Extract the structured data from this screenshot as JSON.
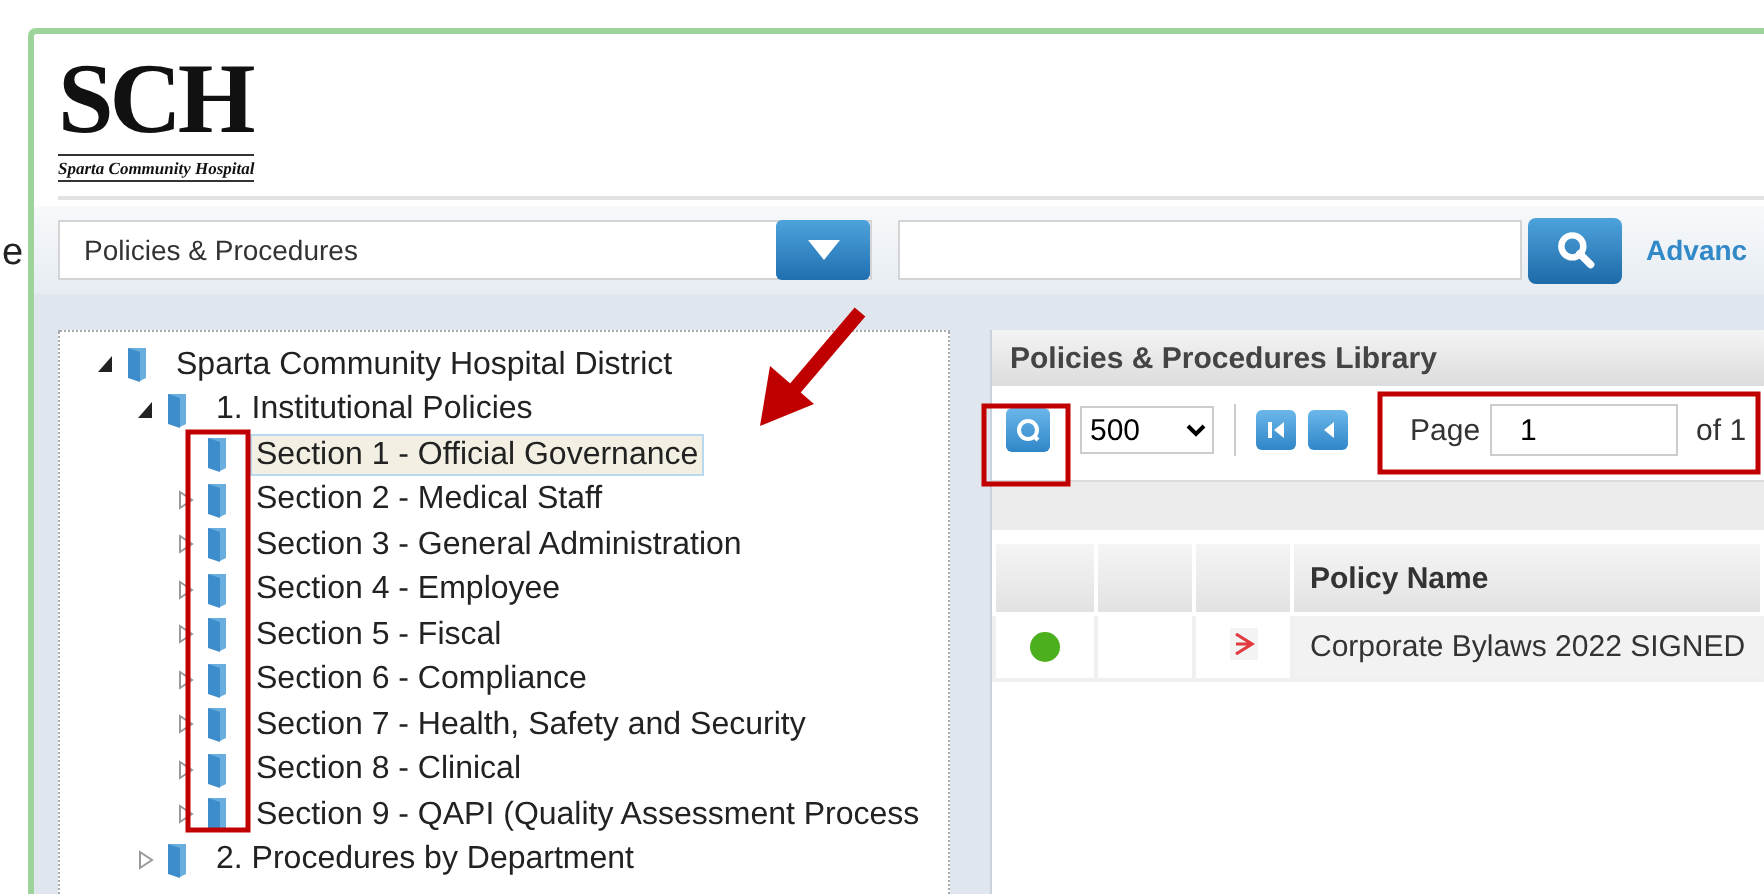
{
  "left_fragment": "e",
  "logo": {
    "text": "SCH",
    "subtitle": "Sparta Community Hospital"
  },
  "search_bar": {
    "category": "Policies & Procedures",
    "advanced_link": "Advanc"
  },
  "tree": [
    {
      "label": "Sparta Community Hospital District",
      "kind": "folder",
      "expanded": true,
      "selected": false,
      "children": [
        {
          "label": "1. Institutional Policies",
          "kind": "folder",
          "expanded": true,
          "selected": false,
          "children": [
            {
              "label": "Section 1 - Official Governance",
              "kind": "leaf",
              "selected": true
            },
            {
              "label": "Section 2 - Medical Staff",
              "kind": "folder",
              "expanded": false,
              "selected": false
            },
            {
              "label": "Section 3 - General Administration",
              "kind": "folder",
              "expanded": false,
              "selected": false
            },
            {
              "label": "Section 4 - Employee",
              "kind": "folder",
              "expanded": false,
              "selected": false
            },
            {
              "label": "Section 5 - Fiscal",
              "kind": "folder",
              "expanded": false,
              "selected": false
            },
            {
              "label": "Section 6 - Compliance",
              "kind": "folder",
              "expanded": false,
              "selected": false
            },
            {
              "label": "Section 7 - Health, Safety and Security",
              "kind": "folder",
              "expanded": false,
              "selected": false
            },
            {
              "label": "Section 8 - Clinical",
              "kind": "folder",
              "expanded": false,
              "selected": false
            },
            {
              "label": "Section 9 - QAPI (Quality Assessment Process",
              "kind": "folder",
              "expanded": false,
              "selected": false
            }
          ]
        },
        {
          "label": "2. Procedures by Department",
          "kind": "folder",
          "expanded": false,
          "selected": false
        }
      ]
    }
  ],
  "library": {
    "title": "Policies & Procedures Library",
    "page_size": "500",
    "page_label": "Page",
    "page": "1",
    "page_total": "of 1",
    "table": {
      "columns": [
        "",
        "",
        "",
        "Policy Name"
      ],
      "rows": [
        {
          "color": "#4caf1e",
          "policy_name": "Corporate Bylaws 2022 SIGNED"
        }
      ]
    }
  }
}
